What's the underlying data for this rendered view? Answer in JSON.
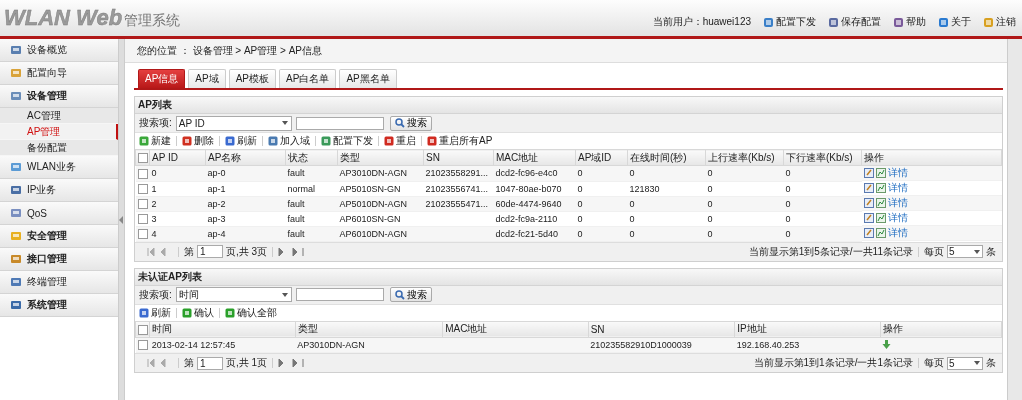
{
  "header": {
    "logo": "WLAN Web",
    "logo_suffix": "管理系统",
    "user_label": "当前用户：",
    "user": "huawei123",
    "actions": [
      {
        "label": "配置下发"
      },
      {
        "label": "保存配置"
      },
      {
        "label": "帮助"
      },
      {
        "label": "关于"
      },
      {
        "label": "注销"
      }
    ]
  },
  "sidebar": {
    "items": [
      {
        "label": "设备概览",
        "emphasized": false
      },
      {
        "label": "配置向导",
        "emphasized": false
      },
      {
        "label": "设备管理",
        "emphasized": true,
        "expanded": true,
        "children": [
          {
            "label": "AC管理",
            "selected": false
          },
          {
            "label": "AP管理",
            "selected": true
          },
          {
            "label": "备份配置",
            "selected": false
          }
        ]
      },
      {
        "label": "WLAN业务",
        "emphasized": false
      },
      {
        "label": "IP业务",
        "emphasized": false
      },
      {
        "label": "QoS",
        "emphasized": false
      },
      {
        "label": "安全管理",
        "emphasized": true
      },
      {
        "label": "接口管理",
        "emphasized": true
      },
      {
        "label": "终端管理",
        "emphasized": false
      },
      {
        "label": "系统管理",
        "emphasized": true
      }
    ]
  },
  "breadcrumb": "您的位置 ： 设备管理 > AP管理 > AP信息",
  "tabs": [
    {
      "label": "AP信息",
      "selected": true
    },
    {
      "label": "AP域",
      "selected": false
    },
    {
      "label": "AP模板",
      "selected": false
    },
    {
      "label": "AP白名单",
      "selected": false
    },
    {
      "label": "AP黑名单",
      "selected": false
    }
  ],
  "panels": [
    {
      "title": "AP列表",
      "search_label": "搜索项:",
      "search_field": "AP ID",
      "search_button": "搜索",
      "toolbar": [
        {
          "label": "新建"
        },
        {
          "label": "删除"
        },
        {
          "label": "刷新"
        },
        {
          "label": "加入域"
        },
        {
          "label": "配置下发"
        },
        {
          "label": "重启"
        },
        {
          "label": "重启所有AP"
        }
      ],
      "all_checked": false,
      "columns": [
        "AP ID",
        "AP名称",
        "状态",
        "类型",
        "SN",
        "MAC地址",
        "AP域ID",
        "在线时间(秒)",
        "上行速率(Kb/s)",
        "下行速率(Kb/s)",
        "操作"
      ],
      "rows": [
        {
          "checked": false,
          "cells": [
            "0",
            "ap-0",
            "fault",
            "AP3010DN-AGN",
            "21023558291...",
            "dcd2-fc96-e4c0",
            "0",
            "0",
            "0",
            "0"
          ],
          "actions": "详情"
        },
        {
          "checked": false,
          "cells": [
            "1",
            "ap-1",
            "normal",
            "AP5010SN-GN",
            "21023556741...",
            "1047-80ae-b070",
            "0",
            "121830",
            "0",
            "0"
          ],
          "actions": "详情"
        },
        {
          "checked": false,
          "cells": [
            "2",
            "ap-2",
            "fault",
            "AP5010DN-AGN",
            "21023555471...",
            "60de-4474-9640",
            "0",
            "0",
            "0",
            "0"
          ],
          "actions": "详情"
        },
        {
          "checked": false,
          "cells": [
            "3",
            "ap-3",
            "fault",
            "AP6010SN-GN",
            "",
            "dcd2-fc9a-2110",
            "0",
            "0",
            "0",
            "0"
          ],
          "actions": "详情"
        },
        {
          "checked": false,
          "cells": [
            "4",
            "ap-4",
            "fault",
            "AP6010DN-AGN",
            "",
            "dcd2-fc21-5d40",
            "0",
            "0",
            "0",
            "0"
          ],
          "actions": "详情"
        }
      ],
      "pager": {
        "page_prefix": "第",
        "page": "1",
        "page_suffix": "页,共 3页",
        "summary": "当前显示第1到5条记录/一共11条记录",
        "per_page_label": "每页",
        "per_page": "5",
        "per_page_unit": "条"
      }
    },
    {
      "title": "未认证AP列表",
      "search_label": "搜索项:",
      "search_field": "时间",
      "search_button": "搜索",
      "toolbar": [
        {
          "label": "刷新"
        },
        {
          "label": "确认"
        },
        {
          "label": "确认全部"
        }
      ],
      "all_checked": false,
      "columns": [
        "时间",
        "类型",
        "MAC地址",
        "SN",
        "IP地址",
        "操作"
      ],
      "rows": [
        {
          "checked": false,
          "cells": [
            "2013-02-14 12:57:45",
            "AP3010DN-AGN",
            "",
            "210235582910D1000039",
            "192.168.40.253"
          ]
        }
      ],
      "pager": {
        "page_prefix": "第",
        "page": "1",
        "page_suffix": "页,共 1页",
        "summary": "当前显示第1到1条记录/一共1条记录",
        "per_page_label": "每页",
        "per_page": "5",
        "per_page_unit": "条"
      }
    }
  ]
}
